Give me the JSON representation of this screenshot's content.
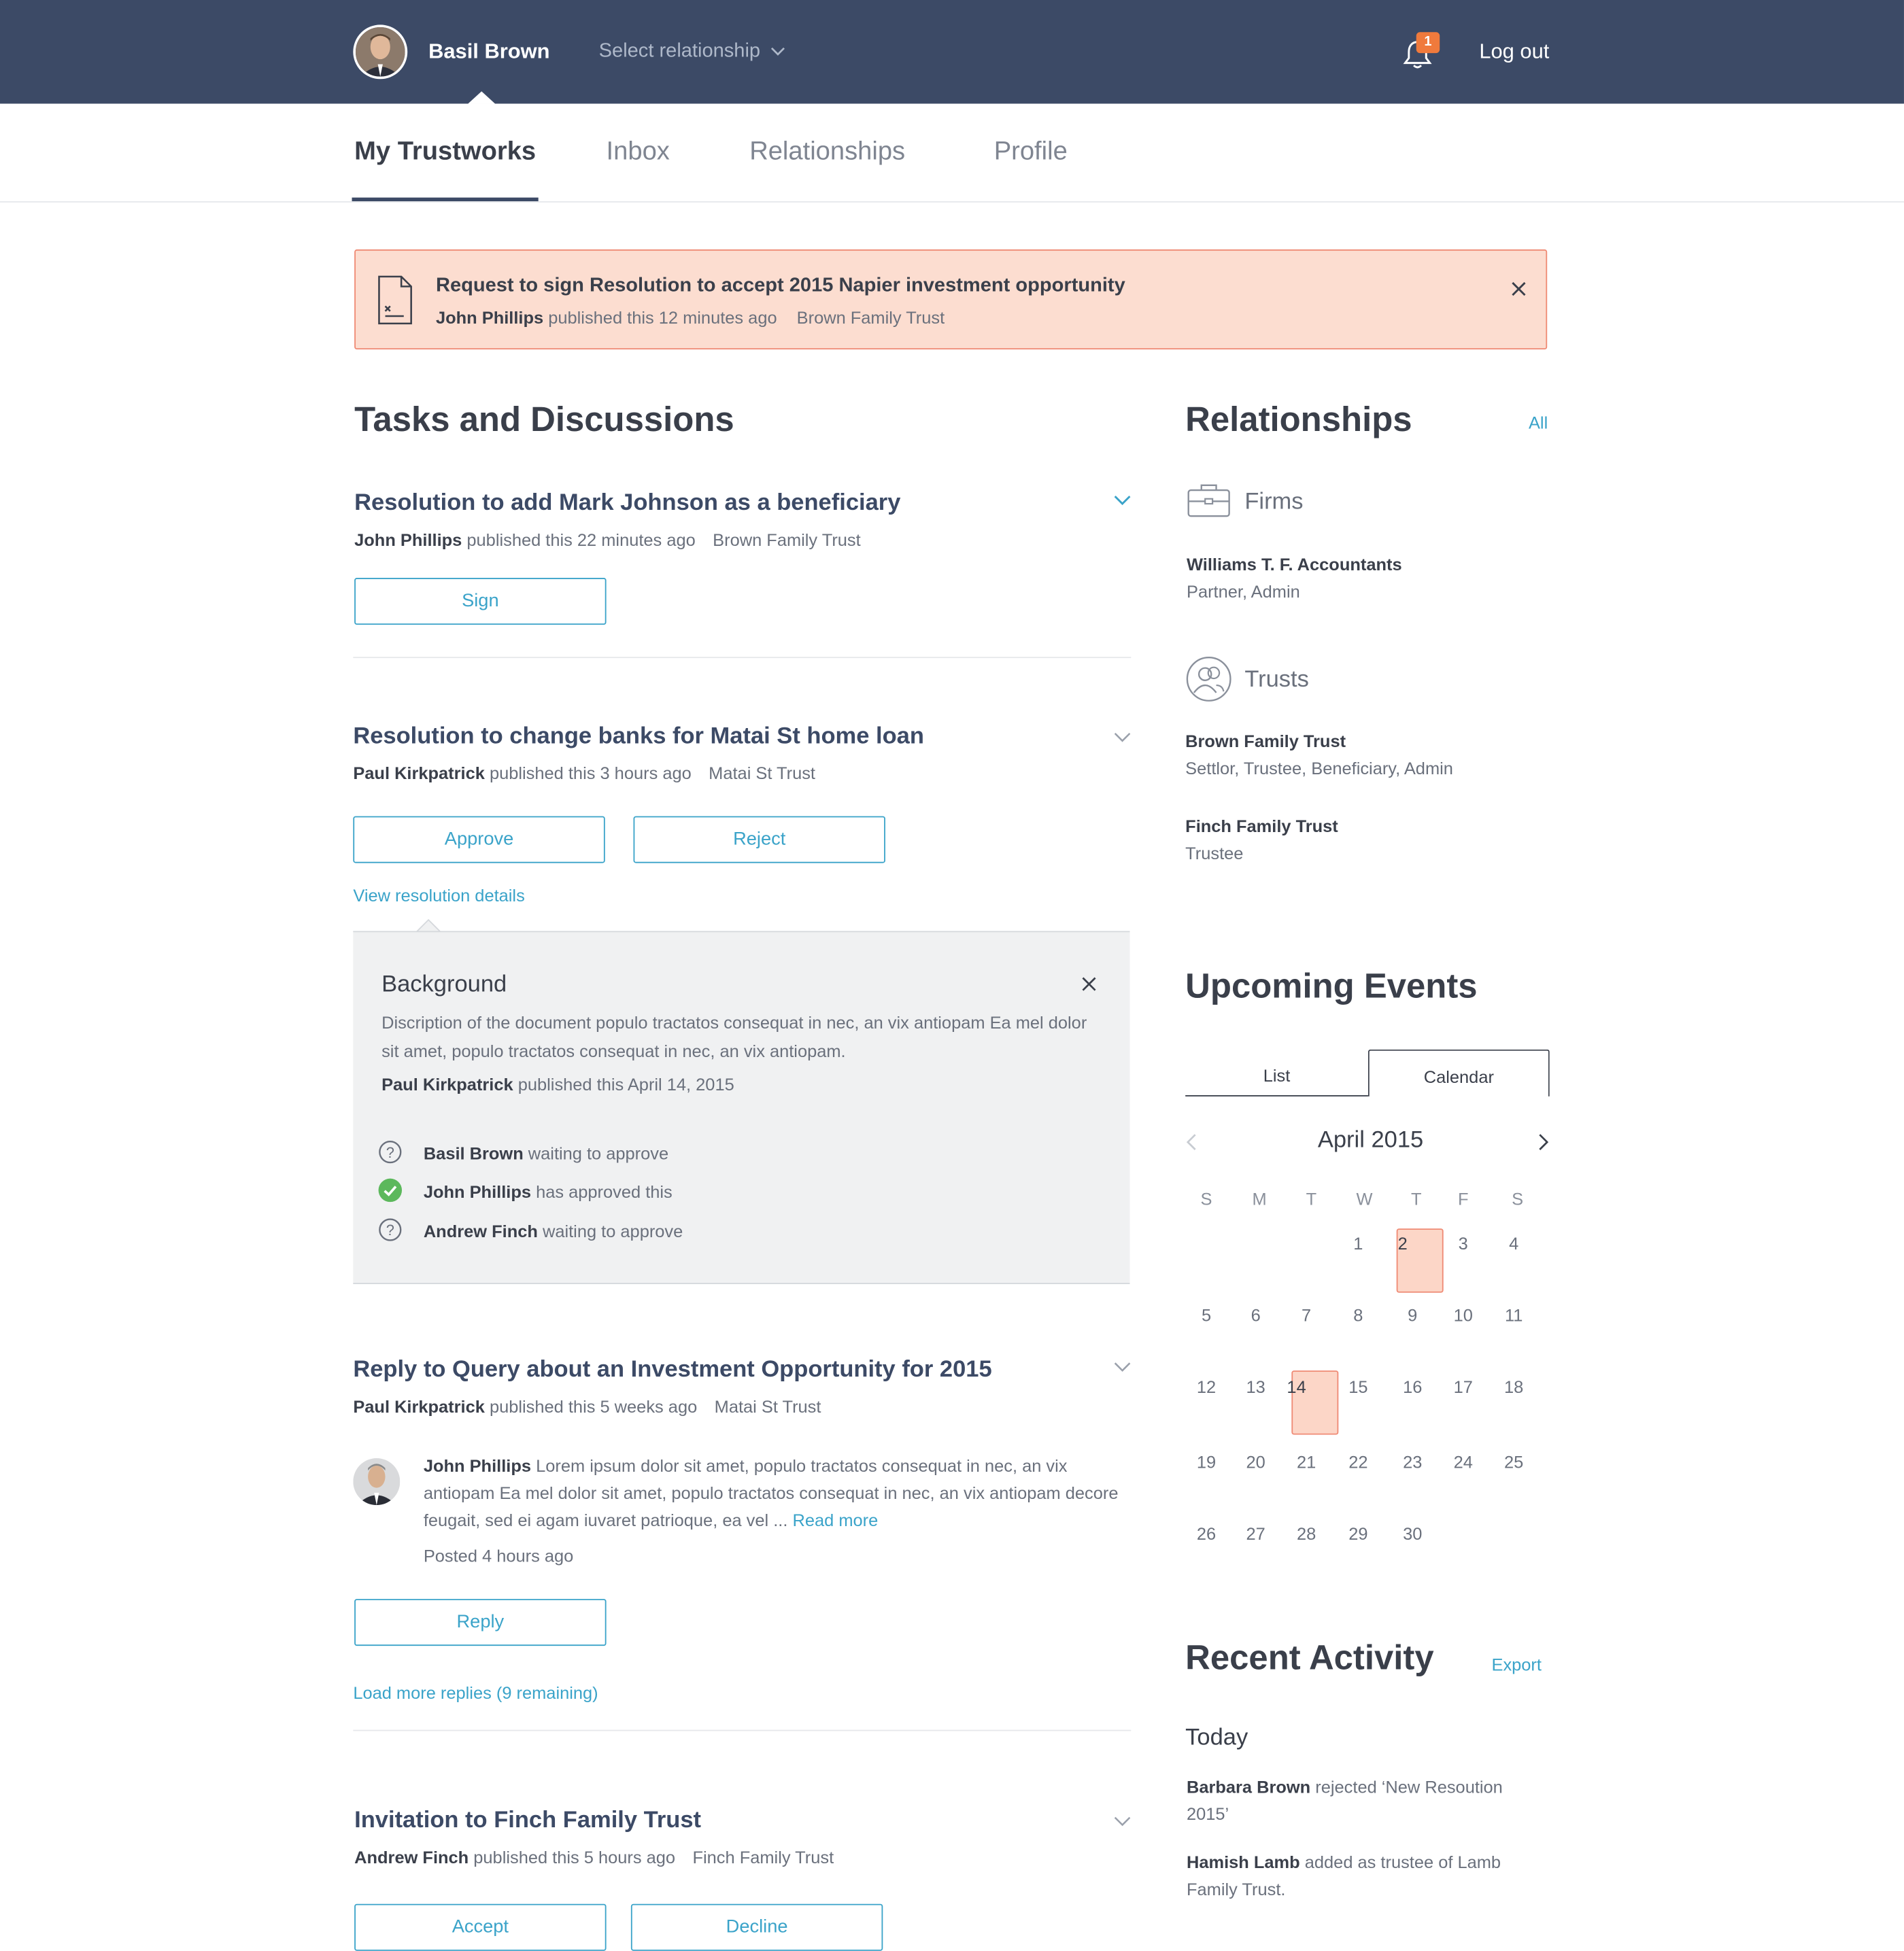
{
  "header": {
    "user_name": "Basil Brown",
    "relationship_select": "Select relationship",
    "notification_count": "1",
    "logout_label": "Log out"
  },
  "nav": {
    "tabs": [
      {
        "label": "My Trustworks",
        "active": true
      },
      {
        "label": "Inbox"
      },
      {
        "label": "Relationships"
      },
      {
        "label": "Profile"
      }
    ]
  },
  "alert": {
    "title": "Request to sign Resolution to accept 2015 Napier investment opportunity",
    "author": "John Phillips",
    "published": "published this 12 minutes ago",
    "trust": "Brown Family Trust"
  },
  "tasks": {
    "title": "Tasks and Discussions",
    "items": [
      {
        "title": "Resolution to add Mark Johnson as a beneficiary",
        "author": "John Phillips",
        "published": "published this 22 minutes ago",
        "trust": "Brown Family Trust",
        "buttons": [
          "Sign"
        ]
      },
      {
        "title": "Resolution to change banks for Matai St home loan",
        "author": "Paul Kirkpatrick",
        "published": "published this 3 hours ago",
        "trust": "Matai St Trust",
        "buttons": [
          "Approve",
          "Reject"
        ],
        "details_link": "View resolution details"
      },
      {
        "title": "Reply to Query about an Investment Opportunity for 2015",
        "author": "Paul Kirkpatrick",
        "published": "published this 5 weeks ago",
        "trust": "Matai St Trust",
        "buttons": [
          "Reply"
        ],
        "load_more": "Load more replies (9 remaining)"
      },
      {
        "title": "Invitation to Finch Family Trust",
        "author": "Andrew Finch",
        "published": "published this 5 hours ago",
        "trust": "Finch Family Trust",
        "buttons": [
          "Accept",
          "Decline"
        ]
      }
    ]
  },
  "details": {
    "heading": "Background",
    "body": "Discription of the document populo tractatos consequat in nec, an vix antiopam Ea mel dolor sit amet, populo tractatos consequat in nec, an vix antiopam.",
    "author": "Paul Kirkpatrick",
    "published": "published this April 14, 2015",
    "statuses": [
      {
        "name": "Basil Brown",
        "text": "waiting to approve",
        "state": "pending"
      },
      {
        "name": "John Phillips",
        "text": "has approved this",
        "state": "approved"
      },
      {
        "name": "Andrew Finch",
        "text": "waiting to approve",
        "state": "pending"
      }
    ]
  },
  "comment": {
    "author": "John Phillips",
    "text": "Lorem ipsum dolor sit amet, populo tractatos consequat in nec, an vix antiopam Ea mel dolor sit amet, populo tractatos consequat in nec, an vix antiopam decore feugait, sed ei agam iuvaret patrioque, ea vel ...",
    "read_more": "Read more",
    "posted": "Posted 4 hours ago"
  },
  "relationships": {
    "title": "Relationships",
    "all_link": "All",
    "firms_heading": "Firms",
    "firms": [
      {
        "name": "Williams T. F. Accountants",
        "role": "Partner, Admin"
      }
    ],
    "trusts_heading": "Trusts",
    "trusts": [
      {
        "name": "Brown Family Trust",
        "role": "Settlor, Trustee, Beneficiary, Admin"
      },
      {
        "name": "Finch Family Trust",
        "role": "Trustee"
      }
    ]
  },
  "events": {
    "title": "Upcoming Events",
    "tabs": [
      "List",
      "Calendar"
    ],
    "active_tab": "Calendar",
    "month": "April 2015",
    "weekdays": [
      "S",
      "M",
      "T",
      "W",
      "T",
      "F",
      "S"
    ],
    "highlighted_days": [
      2,
      14
    ]
  },
  "activity": {
    "title": "Recent Activity",
    "export_link": "Export",
    "day": "Today",
    "items": [
      {
        "name": "Barbara Brown",
        "text": "rejected ‘New Resoution 2015’"
      },
      {
        "name": "Hamish Lamb",
        "text": "added as trustee of Lamb Family Trust."
      }
    ]
  },
  "colors": {
    "header": "#3c4a66",
    "accent": "#3aa3c9",
    "alert_bg": "#fcddd0",
    "alert_border": "#ef8a74",
    "badge": "#f07a3c",
    "approved": "#5cb85c"
  }
}
